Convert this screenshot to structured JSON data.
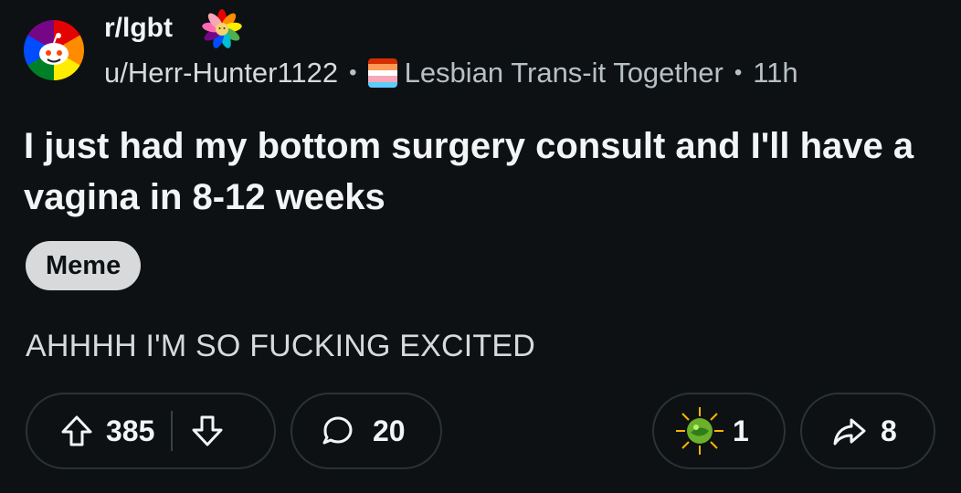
{
  "post": {
    "subreddit": "r/lgbt",
    "author": "u/Herr-Hunter1122",
    "separator": "•",
    "flair_user": "Lesbian Trans-it Together",
    "age": "11h",
    "title": "I just had my bottom surgery consult and I'll have a vagina in 8-12 weeks",
    "flair_tag": "Meme",
    "body": "AHHHH I'M SO FUCKING EXCITED"
  },
  "actions": {
    "upvotes": "385",
    "comments": "20",
    "awards": "1",
    "shares": "8"
  },
  "icons": {
    "subreddit_avatar": "snoo-rainbow-avatar-icon",
    "community_badge": "rainbow-flower-icon",
    "user_flag": "lesbian-trans-flag-icon",
    "upvote": "arrow-up-icon",
    "downvote": "arrow-down-icon",
    "comment": "speech-bubble-icon",
    "award": "award-icon",
    "share": "share-arrow-icon"
  },
  "colors": {
    "background": "#0e1113",
    "text_primary": "#f2f4f5",
    "text_secondary": "#b7c0c4",
    "flair_bg": "#d7d9db",
    "pill_border": "#2b3236"
  }
}
